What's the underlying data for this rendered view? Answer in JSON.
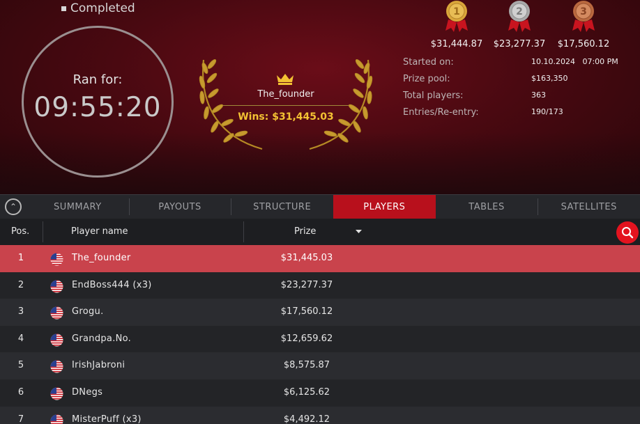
{
  "header": {
    "status": "Completed",
    "timer_label": "Ran for:",
    "timer_value": "09:55:20",
    "winner": {
      "name": "The_founder",
      "wins": "Wins: $31,445.03"
    },
    "medals": [
      {
        "place": "1",
        "prize": "$31,444.87",
        "color": "#d9a63a"
      },
      {
        "place": "2",
        "prize": "$23,277.37",
        "color": "#b9b9b9"
      },
      {
        "place": "3",
        "prize": "$17,560.12",
        "color": "#c0714a"
      }
    ],
    "info": [
      {
        "label": "Started on:",
        "value": "10.10.2024   07:00 PM"
      },
      {
        "label": "Prize pool:",
        "value": "$163,350"
      },
      {
        "label": "Total players:",
        "value": "363"
      },
      {
        "label": "Entries/Re-entry:",
        "value": "190/173"
      }
    ]
  },
  "tabs": [
    {
      "label": "SUMMARY",
      "active": false
    },
    {
      "label": "PAYOUTS",
      "active": false
    },
    {
      "label": "STRUCTURE",
      "active": false
    },
    {
      "label": "PLAYERS",
      "active": true
    },
    {
      "label": "TABLES",
      "active": false
    },
    {
      "label": "SATELLITES",
      "active": false
    }
  ],
  "table": {
    "columns": {
      "pos": "Pos.",
      "name": "Player name",
      "prize": "Prize"
    },
    "rows": [
      {
        "pos": "1",
        "name": "The_founder",
        "prize": "$31,445.03",
        "highlight": true
      },
      {
        "pos": "2",
        "name": "EndBoss444 (x3)",
        "prize": "$23,277.37",
        "highlight": false
      },
      {
        "pos": "3",
        "name": "Grogu.",
        "prize": "$17,560.12",
        "highlight": false
      },
      {
        "pos": "4",
        "name": "Grandpa.No.",
        "prize": "$12,659.62",
        "highlight": false
      },
      {
        "pos": "5",
        "name": "IrishJabroni",
        "prize": "$8,575.87",
        "highlight": false
      },
      {
        "pos": "6",
        "name": "DNegs",
        "prize": "$6,125.62",
        "highlight": false
      },
      {
        "pos": "7",
        "name": "MisterPuff (x3)",
        "prize": "$4,492.12",
        "highlight": false
      }
    ]
  },
  "colors": {
    "accent": "#b8101c",
    "highlight_row": "#c9434c",
    "gold_text": "#f3c233"
  }
}
